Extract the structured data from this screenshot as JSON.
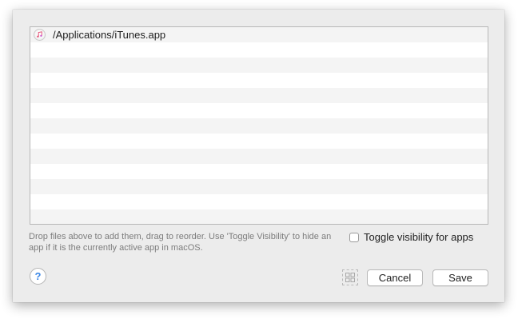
{
  "file_list": {
    "items": [
      {
        "path": "/Applications/iTunes.app",
        "icon": "itunes-icon"
      }
    ]
  },
  "hint_text": "Drop files above to add them, drag to reorder. Use 'Toggle Visibility' to hide an app if it is the currently active app in macOS.",
  "toggle_visibility": {
    "label": "Toggle visibility for apps",
    "checked": false
  },
  "help_button": {
    "label": "?"
  },
  "grid_button": {
    "icon": "grid-icon"
  },
  "buttons": {
    "cancel": "Cancel",
    "save": "Save"
  },
  "colors": {
    "sheet_bg": "#ececec",
    "row_alt": "#f4f4f4",
    "help_accent": "#3b87e6"
  }
}
